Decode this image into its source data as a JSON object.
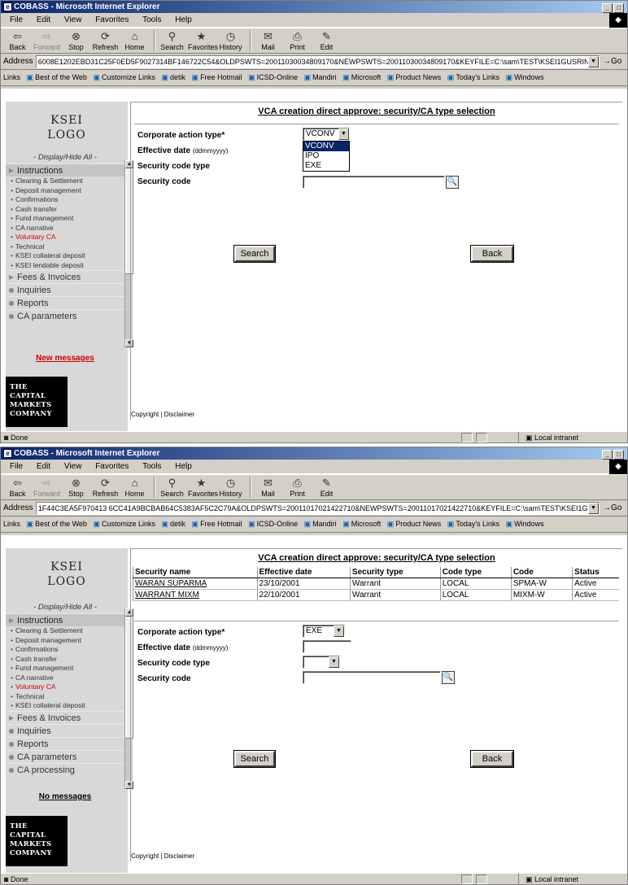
{
  "windows": [
    {
      "title": "COBASS - Microsoft Internet Explorer",
      "menu": [
        "File",
        "Edit",
        "View",
        "Favorites",
        "Tools",
        "Help"
      ],
      "toolbar": {
        "back": "Back",
        "forward": "Forward",
        "stop": "Stop",
        "refresh": "Refresh",
        "home": "Home",
        "search": "Search",
        "favorites": "Favorites",
        "history": "History",
        "mail": "Mail",
        "print": "Print",
        "edit": "Edit"
      },
      "address_label": "Address",
      "address": "6008E1202EBD31C25F0ED5F9027314BF146722C54&OLDPSWTS=20011030034809170&NEWPSWTS=20011030034809170&KEYFILE=C:\\sam\\TEST\\KSEI1GUSRINALDI.key",
      "go": "Go",
      "links_label": "Links",
      "links": [
        "Best of the Web",
        "Customize Links",
        "detik",
        "Free Hotmail",
        "ICSD-Online",
        "Mandiri",
        "Microsoft",
        "Product News",
        "Today's Links",
        "Windows"
      ],
      "status": "Done",
      "zone": "Local intranet",
      "logo_top": [
        "KSEI",
        "LOGO"
      ],
      "display_hide": "- Display/Hide All -",
      "nav_instructions": "Instructions",
      "nav_items": [
        "Clearing & Settlement",
        "Deposit management",
        "Confirmations",
        "Cash transfer",
        "Fund management",
        "CA narrative",
        "Voluntary CA",
        "Technical",
        "KSEI collateral deposit",
        "KSEI lendable deposit"
      ],
      "nav_sections": [
        "Fees & Invoices",
        "Inquiries",
        "Reports",
        "CA parameters"
      ],
      "messages": "New messages",
      "logo_bottom": [
        "THE",
        "CAPITAL",
        "MARKETS",
        "COMPANY"
      ],
      "page_title": "VCA creation direct approve: security/CA type selection",
      "labels": {
        "ca_type": "Corporate action type*",
        "eff_date": "Effective date",
        "date_fmt": "(ddmmyyyy)",
        "sec_code_type": "Security code type",
        "sec_code": "Security code"
      },
      "ca_type_value": "VCONV",
      "ca_type_options": [
        "VCONV",
        "IPO",
        "EXE"
      ],
      "search": "Search",
      "back": "Back",
      "copyright": "Copyright | Disclaimer"
    },
    {
      "title": "COBASS - Microsoft Internet Explorer",
      "menu": [
        "File",
        "Edit",
        "View",
        "Favorites",
        "Tools",
        "Help"
      ],
      "toolbar": {
        "back": "Back",
        "forward": "Forward",
        "stop": "Stop",
        "refresh": "Refresh",
        "home": "Home",
        "search": "Search",
        "favorites": "Favorites",
        "history": "History",
        "mail": "Mail",
        "print": "Print",
        "edit": "Edit"
      },
      "address_label": "Address",
      "address": "1F44C3EA5F970413 6CC41A9BCBAB64C5383AF5C2C79A&OLDPSWTS=20011017021422710&NEWPSWTS=20011017021422710&KEYFILE=C:\\sam\\TEST\\KSEI1GUSRINALDI.key",
      "go": "Go",
      "links_label": "Links",
      "links": [
        "Best of the Web",
        "Customize Links",
        "detik",
        "Free Hotmail",
        "ICSD-Online",
        "Mandiri",
        "Microsoft",
        "Product News",
        "Today's Links",
        "Windows"
      ],
      "status": "Done",
      "zone": "Local intranet",
      "logo_top": [
        "KSEI",
        "LOGO"
      ],
      "display_hide": "- Display/Hide All -",
      "nav_instructions": "Instructions",
      "nav_items": [
        "Clearing & Settlement",
        "Deposit management",
        "Confirmations",
        "Cash transfer",
        "Fund management",
        "CA narrative",
        "Voluntary CA",
        "Technical",
        "KSEI collateral deposit"
      ],
      "nav_sections": [
        "Fees & Invoices",
        "Inquiries",
        "Reports",
        "CA parameters",
        "CA processing"
      ],
      "messages": "No messages",
      "logo_bottom": [
        "THE",
        "CAPITAL",
        "MARKETS",
        "COMPANY"
      ],
      "page_title": "VCA creation direct approve: security/CA type selection",
      "table": {
        "headers": [
          "Security name",
          "Effective date",
          "Security type",
          "Code type",
          "Code",
          "Status"
        ],
        "rows": [
          [
            "WARAN SUPARMA",
            "23/10/2001",
            "Warrant",
            "LOCAL",
            "SPMA-W",
            "Active"
          ],
          [
            "WARRANT MIXM",
            "22/10/2001",
            "Warrant",
            "LOCAL",
            "MIXM-W",
            "Active"
          ]
        ]
      },
      "labels": {
        "ca_type": "Corporate action type*",
        "eff_date": "Effective date",
        "date_fmt": "(ddmmyyyy)",
        "sec_code_type": "Security code type",
        "sec_code": "Security code"
      },
      "ca_type_value": "EXE",
      "search": "Search",
      "back": "Back",
      "copyright": "Copyright | Disclaimer"
    }
  ]
}
